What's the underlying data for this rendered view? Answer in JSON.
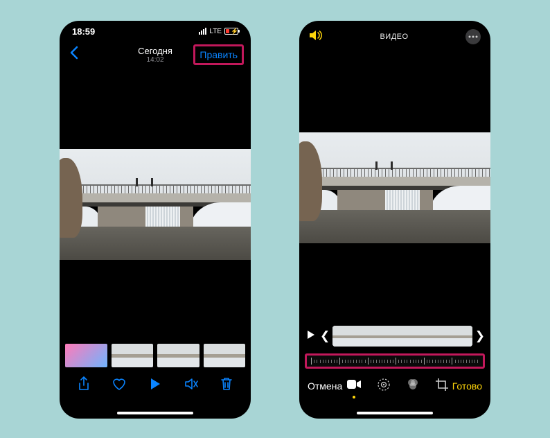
{
  "phone1": {
    "status": {
      "time": "18:59",
      "carrier_label": "LTE"
    },
    "nav": {
      "title": "Сегодня",
      "subtitle": "14:02",
      "edit_label": "Править"
    }
  },
  "phone2": {
    "header": {
      "title": "ВИДЕО"
    },
    "footer": {
      "cancel_label": "Отмена",
      "done_label": "Готово"
    }
  }
}
